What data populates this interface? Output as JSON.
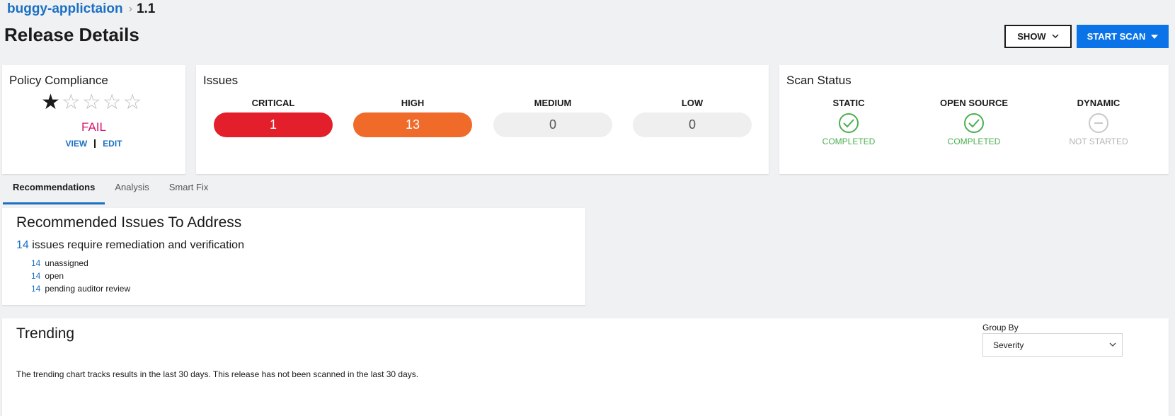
{
  "breadcrumb": {
    "app": "buggy-applictaion",
    "version": "1.1"
  },
  "page_title": "Release Details",
  "actions": {
    "show_label": "SHOW",
    "start_scan_label": "START SCAN",
    "accent": "#0b73e8"
  },
  "policy": {
    "title": "Policy Compliance",
    "rating": 1,
    "rating_max": 5,
    "status": "FAIL",
    "view_label": "VIEW",
    "edit_label": "EDIT"
  },
  "issues": {
    "title": "Issues",
    "severities": [
      {
        "label": "CRITICAL",
        "count": "1",
        "color": "#e21f2b"
      },
      {
        "label": "HIGH",
        "count": "13",
        "color": "#f06a2a"
      },
      {
        "label": "MEDIUM",
        "count": "0",
        "color": "#efeff0"
      },
      {
        "label": "LOW",
        "count": "0",
        "color": "#efeff0"
      }
    ]
  },
  "scan_status": {
    "title": "Scan Status",
    "items": [
      {
        "label": "STATIC",
        "status": "COMPLETED",
        "icon": "check-circle-icon"
      },
      {
        "label": "OPEN SOURCE",
        "status": "COMPLETED",
        "icon": "check-circle-icon"
      },
      {
        "label": "DYNAMIC",
        "status": "NOT STARTED",
        "icon": "minus-circle-icon"
      }
    ]
  },
  "tabs": [
    "Recommendations",
    "Analysis",
    "Smart Fix"
  ],
  "recommendations": {
    "title": "Recommended Issues To Address",
    "summary_count": "14",
    "summary_text": "issues require remediation and verification",
    "items": [
      {
        "count": "14",
        "text": "unassigned"
      },
      {
        "count": "14",
        "text": "open"
      },
      {
        "count": "14",
        "text": "pending auditor review"
      }
    ]
  },
  "trending": {
    "title": "Trending",
    "group_by_label": "Group By",
    "group_by_value": "Severity",
    "note": "The trending chart tracks results in the last 30 days. This release has not been scanned in the last 30 days."
  }
}
